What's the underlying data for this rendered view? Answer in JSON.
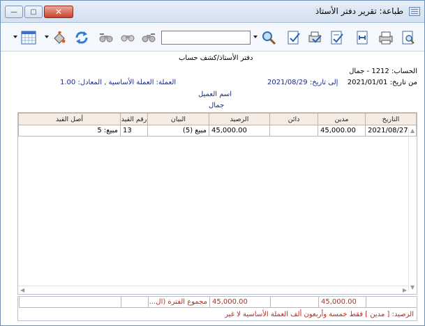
{
  "window": {
    "title": "طباعة: تقرير دفتر الأستاذ",
    "close_label": "✕",
    "max_label": "▢",
    "min_label": "—"
  },
  "toolbar": {
    "search_value": "",
    "icons": [
      "preview-icon",
      "print-icon",
      "fit-page-icon",
      "export-icon",
      "print-setup-icon",
      "select-icon",
      "find-icon",
      "find-next-icon",
      "find-prev-icon",
      "back-icon",
      "refresh-icon",
      "fill-icon",
      "color-grid-icon"
    ]
  },
  "report": {
    "title": "دفتر الأستاذ/كشف حساب",
    "account": "الحساب: 1212 - جمال",
    "from_label": "من تاريخ:",
    "from_date": "2021/01/01",
    "to_label": "إلى تاريخ:",
    "to_date": "2021/08/29",
    "currency": "العملة: العملة الأساسية , المعادل: 1.00",
    "customer_label": "اسم العميل",
    "customer_name": "جمال"
  },
  "table": {
    "columns": [
      "التاريخ",
      "مدين",
      "دائن",
      "الرصيد",
      "البيان",
      "رقم القيد",
      "أصل القيد"
    ],
    "rows": [
      [
        "2021/08/27",
        "45,000.00",
        "",
        "45,000.00",
        "مبيع (5)",
        "13",
        "مبيع: 5"
      ]
    ]
  },
  "totals": {
    "debit_total": "45,000.00",
    "credit_total": "",
    "balance_total": "45,000.00",
    "period_total_label": "مجموع الفترة (ال...",
    "balance_text": "الرصيد: [ مدين ] فقط خمسة وأربعون ألف العملة الأساسية لا غير"
  },
  "colors": {
    "header_bg": "#f7ece3",
    "red_text": "#c0281e",
    "blue_text": "#1b2a88"
  }
}
